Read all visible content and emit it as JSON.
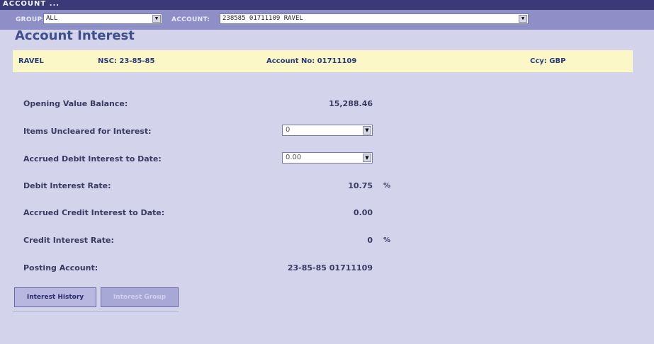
{
  "window": {
    "title": "ACCOUNT ..."
  },
  "selector": {
    "group_label": "GROUP:",
    "group_value": "ALL",
    "account_label": "ACCOUNT:",
    "account_value": "238585 01711109 RAVEL"
  },
  "page": {
    "title": "Account Interest"
  },
  "infobar": {
    "name": "RAVEL",
    "nsc": "NSC: 23-85-85",
    "account_no": "Account No: 01711109",
    "currency": "Ccy: GBP"
  },
  "fields": {
    "opening_value_balance": {
      "label": "Opening Value Balance:",
      "value": "15,288.46"
    },
    "items_uncleared": {
      "label": "Items Uncleared for Interest:",
      "value": "0"
    },
    "accrued_debit": {
      "label": "Accrued Debit Interest to Date:",
      "value": "0.00"
    },
    "debit_rate": {
      "label": "Debit Interest Rate:",
      "value": "10.75",
      "unit": "%"
    },
    "accrued_credit": {
      "label": "Accrued Credit Interest to Date:",
      "value": "0.00"
    },
    "credit_rate": {
      "label": "Credit Interest Rate:",
      "value": "0",
      "unit": "%"
    },
    "posting_account": {
      "label": "Posting Account:",
      "value": "23-85-85 01711109"
    }
  },
  "buttons": {
    "interest_history": "Interest History",
    "interest_group": "Interest Group"
  },
  "colors": {
    "background": "#d3d3ec",
    "selector_bar": "#8f8fc8",
    "info_bar": "#fbf7c6",
    "title": "#3f4f8c"
  },
  "icons": {
    "dropdown": "chevron-down-icon"
  }
}
